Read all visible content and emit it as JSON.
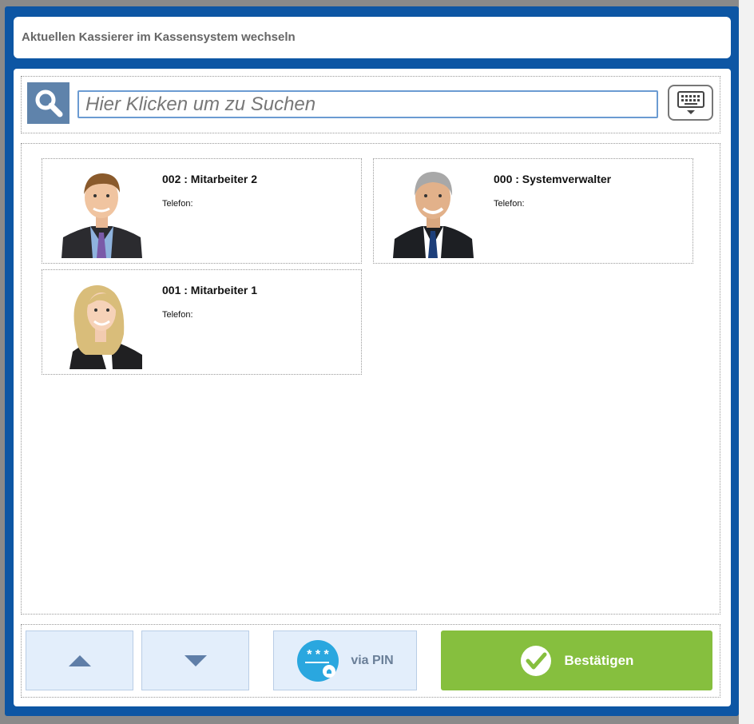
{
  "dialog": {
    "title": "Aktuellen Kassierer im Kassensystem wechseln"
  },
  "search": {
    "placeholder": "Hier Klicken um zu Suchen",
    "value": ""
  },
  "icons": {
    "search": "search-icon",
    "keyboard": "keyboard-icon",
    "up": "arrow-up-icon",
    "down": "arrow-down-icon",
    "pin": "pin-icon",
    "confirm": "checkmark-icon"
  },
  "employees": [
    {
      "name": "002 : Mitarbeiter 2",
      "phone_label": "Telefon:",
      "photo": "man-blue-shirt-photo"
    },
    {
      "name": "000 : Systemverwalter",
      "phone_label": "Telefon:",
      "photo": "gray-haired-man-photo"
    },
    {
      "name": "001 : Mitarbeiter 1",
      "phone_label": "Telefon:",
      "photo": "blonde-woman-photo"
    }
  ],
  "actions": {
    "pin_label": "via PIN",
    "pin_badge": "* * *",
    "confirm_label": "Bestätigen"
  },
  "colors": {
    "frame": "#0d56a4",
    "search_button": "#5f83ab",
    "nav_button": "#e3eefb",
    "confirm_button": "#86bf3e",
    "pin_circle": "#2aa7df"
  }
}
